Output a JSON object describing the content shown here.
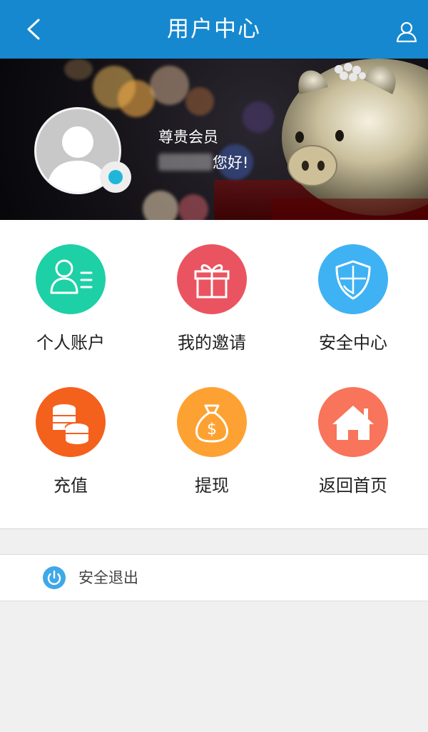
{
  "header": {
    "title": "用户中心",
    "bg_color": "#1688cf",
    "back_icon": "chevron-left-icon",
    "user_icon": "user-icon"
  },
  "profile": {
    "member_level": "尊贵会员",
    "greeting": "您好!"
  },
  "menu": [
    {
      "label": "个人账户",
      "icon": "personal-account-icon",
      "color": "#1ed0a6"
    },
    {
      "label": "我的邀请",
      "icon": "gift-icon",
      "color": "#ea5460"
    },
    {
      "label": "安全中心",
      "icon": "shield-icon",
      "color": "#3fb2f4"
    },
    {
      "label": "充值",
      "icon": "coins-icon",
      "color": "#f4611c"
    },
    {
      "label": "提现",
      "icon": "money-bag-icon",
      "color": "#fda232"
    },
    {
      "label": "返回首页",
      "icon": "home-icon",
      "color": "#f8745a"
    }
  ],
  "logout": {
    "label": "安全退出",
    "icon": "power-icon",
    "color": "#3fa8e8"
  }
}
